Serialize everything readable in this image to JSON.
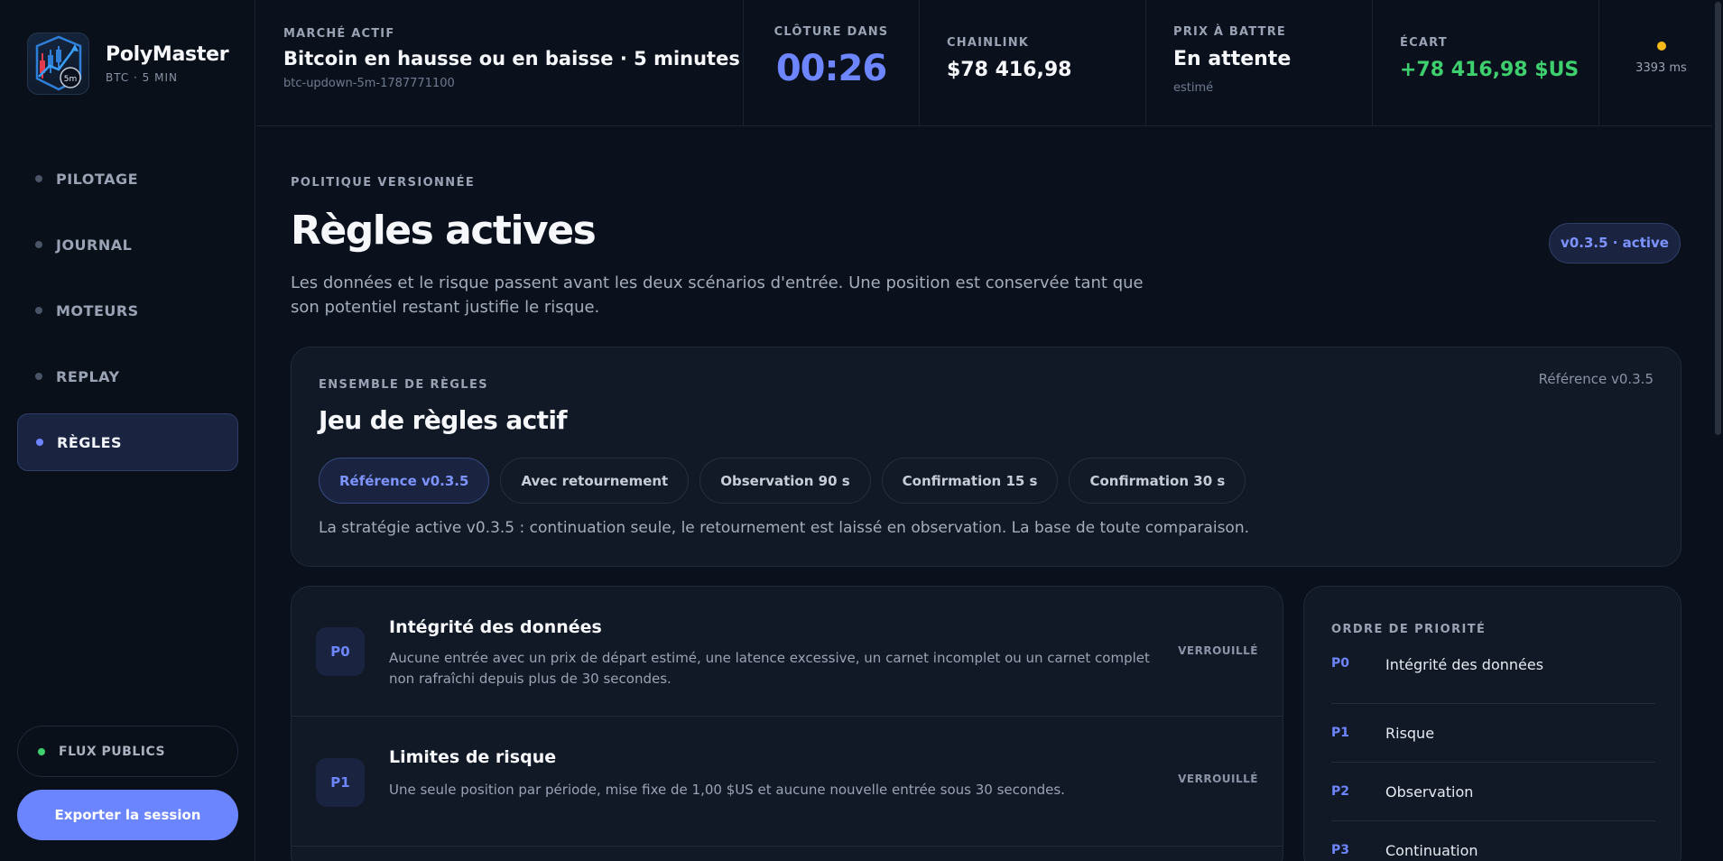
{
  "brand": {
    "name": "PolyMaster",
    "subtitle": "BTC · 5 MIN",
    "logo_badge": "5m"
  },
  "nav": {
    "items": [
      {
        "label": "PILOTAGE",
        "active": false
      },
      {
        "label": "JOURNAL",
        "active": false
      },
      {
        "label": "MOTEURS",
        "active": false
      },
      {
        "label": "REPLAY",
        "active": false
      },
      {
        "label": "RÈGLES",
        "active": true
      }
    ]
  },
  "sidebar_footer": {
    "flux_label": "FLUX PUBLICS",
    "export_label": "Exporter la session"
  },
  "topbar": {
    "market": {
      "label": "MARCHÉ ACTIF",
      "title": "Bitcoin en hausse ou en baisse · 5 minutes",
      "slug": "btc-updown-5m-1787771100"
    },
    "closing": {
      "label": "CLÔTURE DANS",
      "value": "00:26"
    },
    "chainlink": {
      "label": "CHAINLINK",
      "value": "$78 416,98"
    },
    "target": {
      "label": "PRIX À BATTRE",
      "value": "En attente",
      "sub": "estimé"
    },
    "gap": {
      "label": "ÉCART",
      "value": "+78 416,98 $US"
    },
    "latency": {
      "value": "3393 ms"
    }
  },
  "page": {
    "eyebrow": "POLITIQUE VERSIONNÉE",
    "title": "Règles actives",
    "description": "Les données et le risque passent avant les deux scénarios d'entrée. Une position est conservée tant que son potentiel restant justifie le risque.",
    "version_badge": "v0.3.5 · active"
  },
  "ruleset": {
    "eyebrow": "ENSEMBLE DE RÈGLES",
    "reference": "Référence v0.3.5",
    "title": "Jeu de règles actif",
    "chips": [
      {
        "label": "Référence v0.3.5",
        "active": true
      },
      {
        "label": "Avec retournement",
        "active": false
      },
      {
        "label": "Observation 90 s",
        "active": false
      },
      {
        "label": "Confirmation 15 s",
        "active": false
      },
      {
        "label": "Confirmation 30 s",
        "active": false
      }
    ],
    "description": "La stratégie active v0.3.5 : continuation seule, le retournement est laissé en observation. La base de toute comparaison."
  },
  "rules": [
    {
      "code": "P0",
      "title": "Intégrité des données",
      "description": "Aucune entrée avec un prix de départ estimé, une latence excessive, un carnet incomplet ou un carnet complet non rafraîchi depuis plus de 30 secondes.",
      "status": "VERROUILLÉ"
    },
    {
      "code": "P1",
      "title": "Limites de risque",
      "description": "Une seule position par période, mise fixe de 1,00 $US et aucune nouvelle entrée sous 30 secondes.",
      "status": "VERROUILLÉ"
    }
  ],
  "priority": {
    "eyebrow": "ORDRE DE PRIORITÉ",
    "items": [
      {
        "code": "P0",
        "label": "Intégrité des données"
      },
      {
        "code": "P1",
        "label": "Risque"
      },
      {
        "code": "P2",
        "label": "Observation"
      },
      {
        "code": "P3",
        "label": "Continuation"
      }
    ]
  },
  "colors": {
    "accent": "#6d86ff",
    "positive": "#3ecf6e",
    "warning": "#f5b91a",
    "background": "#0b111c"
  },
  "icons": {
    "logo": "candlestick-chart-icon",
    "status_dot": "status-dot-icon"
  }
}
